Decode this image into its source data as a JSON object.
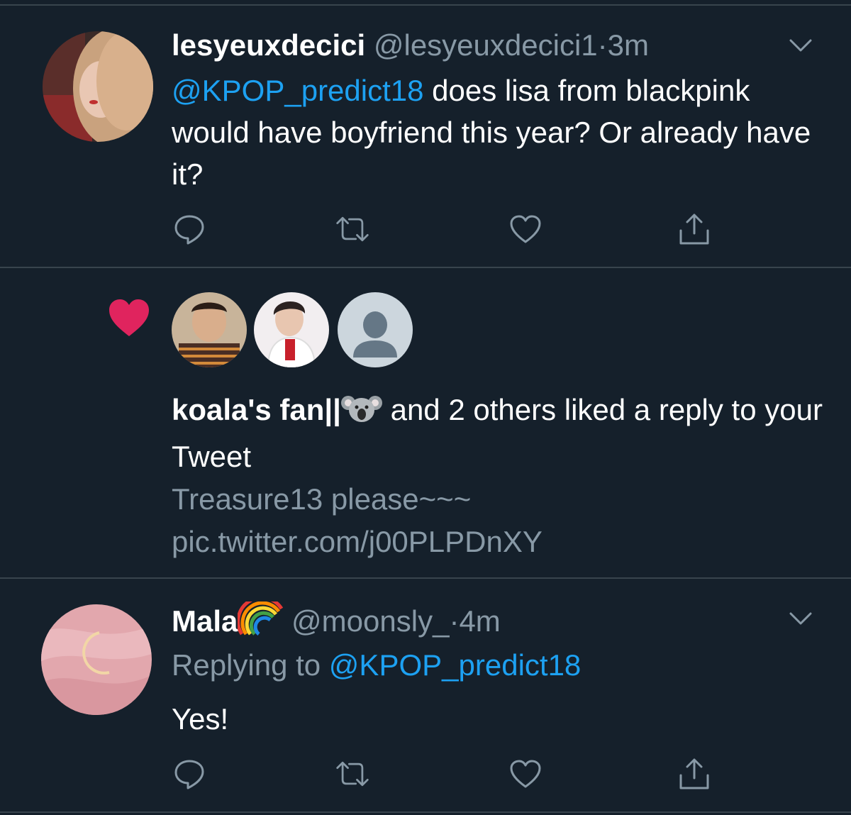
{
  "tweet1": {
    "display_name": "lesyeuxdecici",
    "handle": "@lesyeuxdecici1",
    "separator": "·",
    "time": "3m",
    "mention": "@KPOP_predict18",
    "text": " does lisa from blackpink would have boyfriend this year? Or already have it?"
  },
  "notification": {
    "actor_name": "koala's fan||",
    "actor_emoji": "koala-emoji",
    "rest": " and 2 others liked a reply to your Tweet",
    "preview": "Treasure13 please~~~ pic.twitter.com/j00PLPDnXY"
  },
  "tweet2": {
    "display_name": "Mala",
    "name_emoji": "rainbow-emoji",
    "handle": "@moonsly_",
    "separator": "·",
    "time": "4m",
    "replying_label": "Replying to ",
    "replying_handle": "@KPOP_predict18",
    "text": "Yes!"
  },
  "icons": {
    "reply": "reply-icon",
    "retweet": "retweet-icon",
    "like": "like-icon",
    "share": "share-icon",
    "more": "chevron-down-icon"
  },
  "colors": {
    "background": "#15202b",
    "divider": "#38444d",
    "secondary_text": "#8899a6",
    "link": "#1da1f2",
    "like_heart": "#e0245e"
  }
}
